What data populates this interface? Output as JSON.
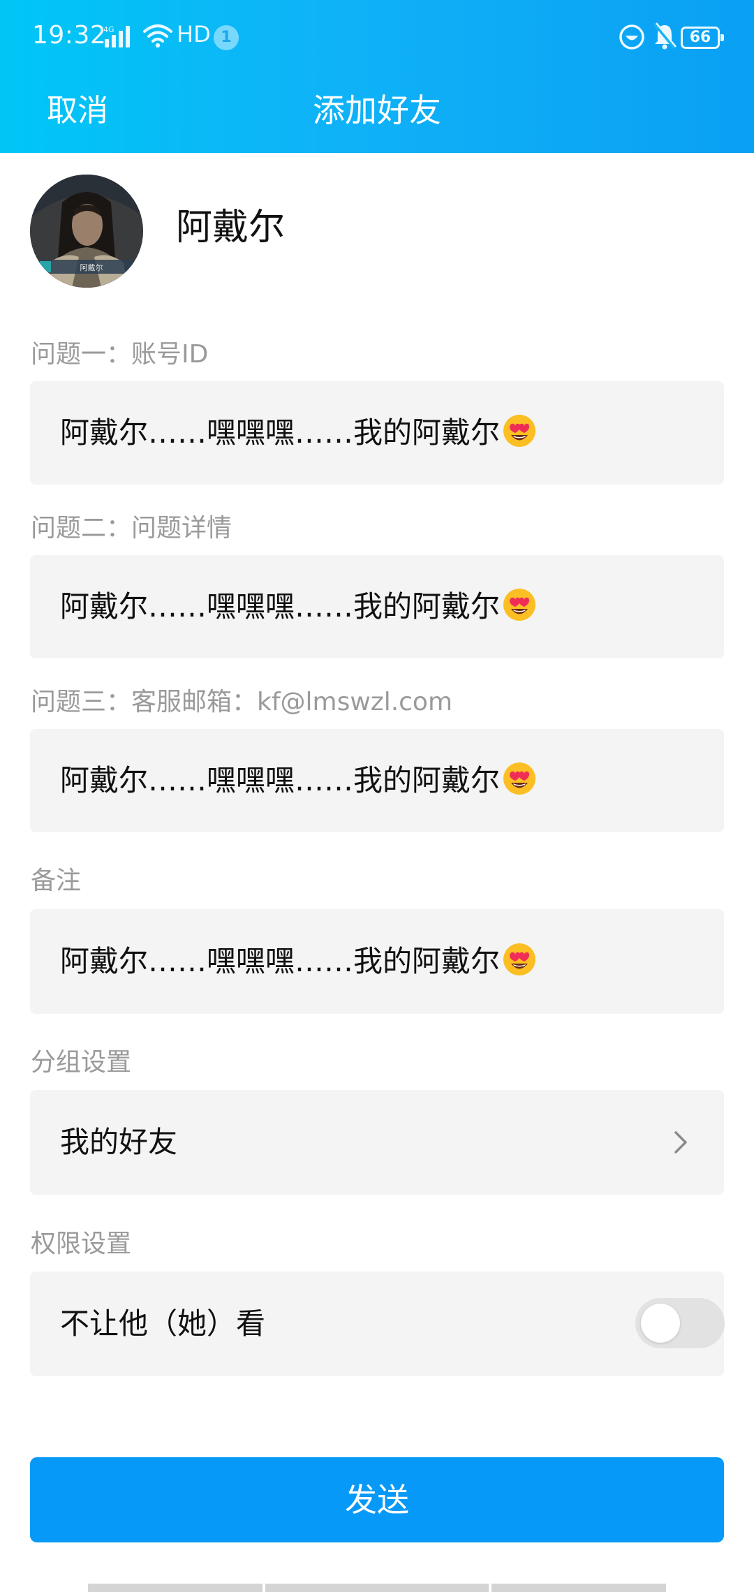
{
  "status_bar": {
    "time": "19:32",
    "network": "4G",
    "hd": "HD",
    "notification_count": "1",
    "battery": "66"
  },
  "nav": {
    "cancel_label": "取消",
    "title": "添加好友"
  },
  "profile": {
    "name": "阿戴尔",
    "avatar_caption": "阿戴尔"
  },
  "questions": [
    {
      "label": "问题一：账号ID",
      "answer": "阿戴尔……嘿嘿嘿……我的阿戴尔"
    },
    {
      "label": "问题二：问题详情",
      "answer": "阿戴尔……嘿嘿嘿……我的阿戴尔"
    },
    {
      "label": "问题三：客服邮箱：kf@lmswzl.com",
      "answer": "阿戴尔……嘿嘿嘿……我的阿戴尔"
    }
  ],
  "remark": {
    "label": "备注",
    "value": "阿戴尔……嘿嘿嘿……我的阿戴尔"
  },
  "group": {
    "label": "分组设置",
    "value": "我的好友"
  },
  "permission": {
    "label": "权限设置",
    "option_label": "不让他（她）看",
    "enabled": false
  },
  "emoji": "heart-eyes-emoji",
  "send_label": "发送",
  "colors": {
    "header_start": "#00c6f6",
    "header_end": "#0aa0f4",
    "send_button": "#0799f7",
    "field_bg": "#f4f4f4",
    "label_gray": "#9a9a9a"
  }
}
